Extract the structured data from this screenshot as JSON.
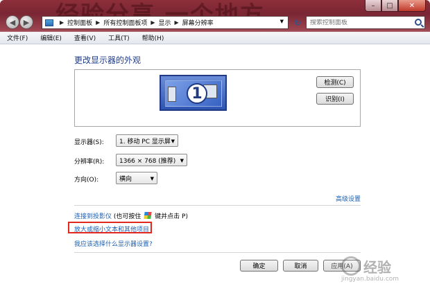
{
  "titlebar": {
    "watermark_text": "经验分享 一个地方",
    "min_symbol": "–",
    "max_symbol": "□",
    "close_symbol": "✕"
  },
  "nav": {
    "back_symbol": "◀",
    "forward_symbol": "▶",
    "breadcrumb": [
      "控制面板",
      "所有控制面板项",
      "显示",
      "屏幕分辨率"
    ],
    "refresh_symbol": "↻",
    "search_placeholder": "搜索控制面板"
  },
  "menubar": {
    "items": [
      "文件(F)",
      "编辑(E)",
      "查看(V)",
      "工具(T)",
      "帮助(H)"
    ]
  },
  "main": {
    "heading": "更改显示器的外观",
    "monitor_number": "1",
    "detect_button": "检测(C)",
    "identify_button": "识别(I)",
    "display_label": "显示器(S):",
    "display_value": "1. 移动 PC 显示屏",
    "resolution_label": "分辨率(R):",
    "resolution_value": "1366 × 768 (推荐)",
    "orientation_label": "方向(O):",
    "orientation_value": "横向",
    "advanced_link": "高级设置",
    "projector_link": "连接到投影仪",
    "projector_hint_pre": "(也可按住",
    "projector_hint_post": "键并点击 P)",
    "text_size_link": "放大或缩小文本和其他项目",
    "help_link": "我应该选择什么显示器设置?",
    "ok_button": "确定",
    "cancel_button": "取消",
    "apply_button": "应用(A)"
  },
  "watermark": {
    "text": "经验",
    "url": "jingyan.baidu.com"
  },
  "colors": {
    "title_accent": "#1e3c8a",
    "link": "#1a5fb4",
    "highlight_box": "#e0281e"
  }
}
